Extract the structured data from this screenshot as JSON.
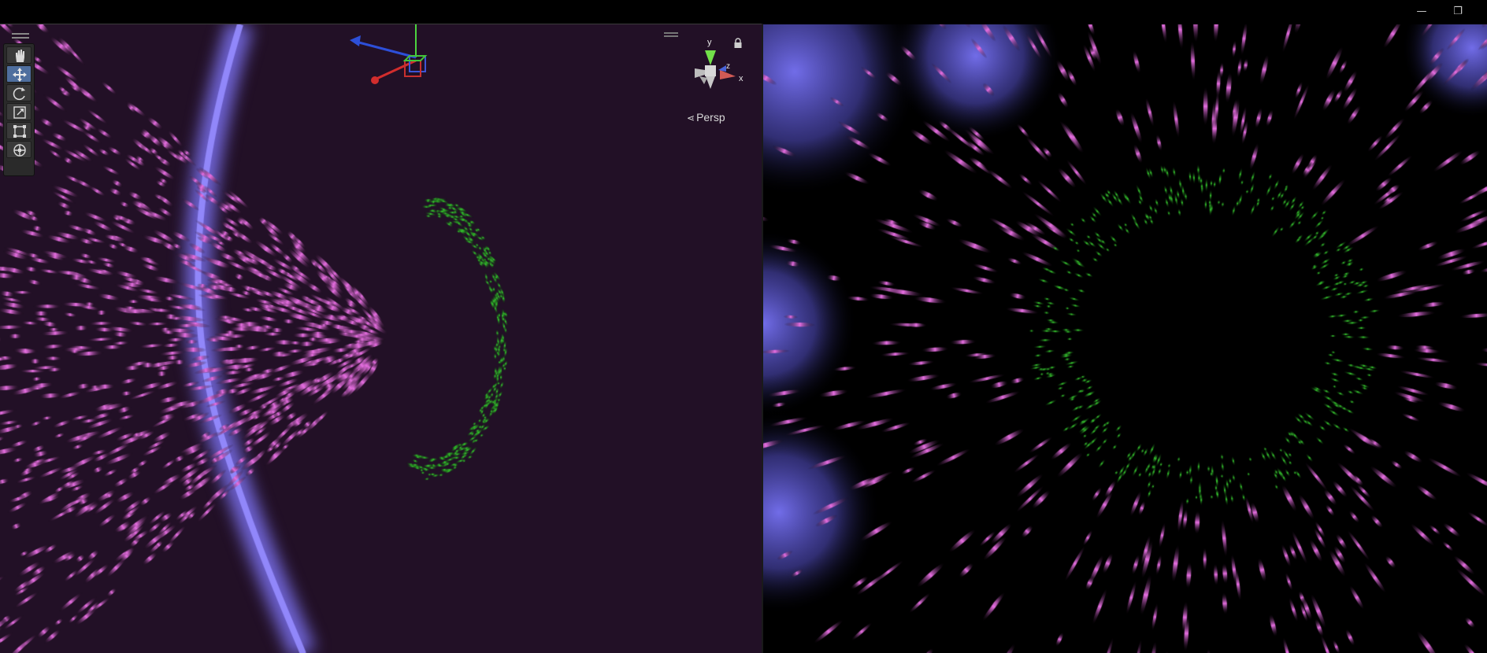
{
  "window": {
    "minimize_icon": "minimize-icon",
    "restore_icon": "restore-icon",
    "minimize_glyph": "—",
    "restore_glyph": "❐"
  },
  "scene_view": {
    "tools": [
      {
        "name": "hand-tool",
        "icon": "hand-icon",
        "active": false
      },
      {
        "name": "move-tool",
        "icon": "move-icon",
        "active": true
      },
      {
        "name": "rotate-tool",
        "icon": "rotate-icon",
        "active": false
      },
      {
        "name": "scale-tool",
        "icon": "scale-icon",
        "active": false
      },
      {
        "name": "rect-tool",
        "icon": "rect-transform-icon",
        "active": false
      },
      {
        "name": "transform-tool",
        "icon": "transform-icon",
        "active": false
      }
    ],
    "gizmo": {
      "axes": {
        "y": "y",
        "z": "z",
        "x": "x"
      },
      "projection_label": "Persp"
    },
    "colors": {
      "background": "#221026",
      "streaks": "#e86fe3",
      "ring": "#35c42e",
      "ribbon": "#7c72f2"
    }
  },
  "game_view": {
    "colors": {
      "background": "#000000",
      "streaks": "#e86fe3",
      "ring": "#35c42e",
      "glow": "#6e6ae6"
    }
  }
}
